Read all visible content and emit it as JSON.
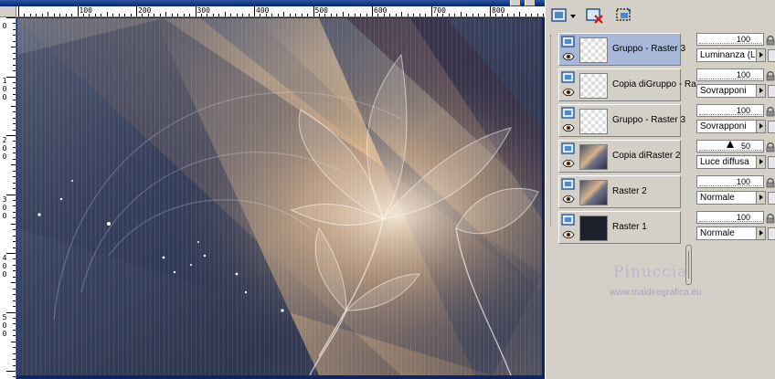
{
  "ruler": {
    "top_labels": [
      "100",
      "200",
      "300",
      "400",
      "500",
      "600",
      "700",
      "800"
    ],
    "left_labels": [
      "0",
      "1",
      "0",
      "0",
      "2",
      "0",
      "0",
      "3",
      "0",
      "0",
      "4",
      "0",
      "0",
      "5",
      "0",
      "0"
    ]
  },
  "toolbar": {
    "new_layer_icon": "new-raster-layer-icon",
    "delete_layer_icon": "delete-layer-icon",
    "mask_icon": "mask-icon"
  },
  "layers": [
    {
      "name": "Gruppo - Raster 3",
      "thumb": "checker",
      "selected": true,
      "opacity": "100",
      "blend": "Luminanza (L)"
    },
    {
      "name": "Copia diGruppo - Ra",
      "thumb": "checker",
      "selected": false,
      "opacity": "100",
      "blend": "Sovrapponi"
    },
    {
      "name": "Gruppo - Raster 3",
      "thumb": "checker",
      "selected": false,
      "opacity": "100",
      "blend": "Sovrapponi"
    },
    {
      "name": "Copia diRaster 2",
      "thumb": "image",
      "selected": false,
      "opacity": "50",
      "blend": "Luce diffusa"
    },
    {
      "name": "Raster 2",
      "thumb": "image",
      "selected": false,
      "opacity": "100",
      "blend": "Normale"
    },
    {
      "name": "Raster 1",
      "thumb": "dark",
      "selected": false,
      "opacity": "100",
      "blend": "Normale"
    }
  ],
  "watermark": {
    "name": "Pinuccia",
    "url": "www.maidiregrafica.eu"
  },
  "colors": {
    "selection": "#a8b8d8",
    "panel": "#d4d0c8",
    "title": "#0a246a"
  }
}
